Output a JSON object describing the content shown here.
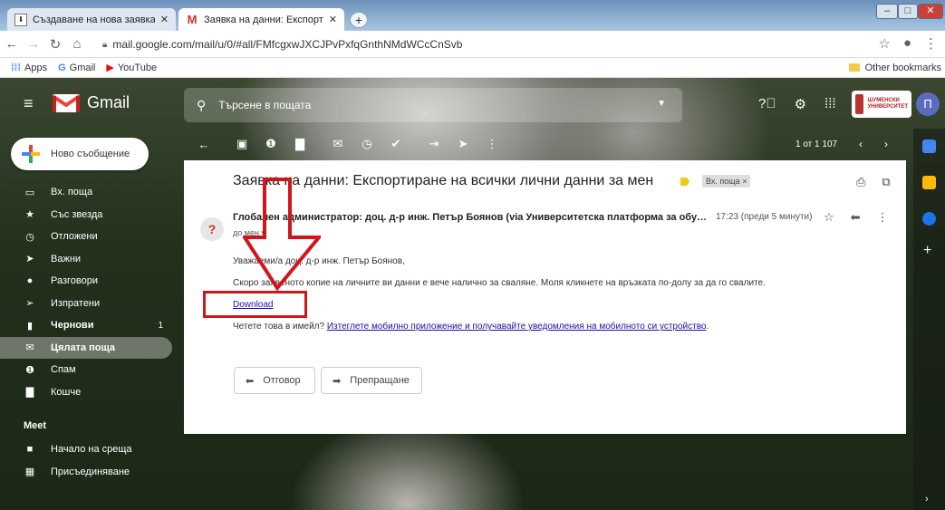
{
  "browser": {
    "tabs": [
      {
        "title": "Създаване на нова заявка за д",
        "close": "✕"
      },
      {
        "title": "Заявка на данни: Експортиране",
        "close": "✕"
      }
    ],
    "new_tab": "+",
    "url": "mail.google.com/mail/u/0/#all/FMfcgxwJXCJPvPxfqGnthNMdWCcCnSvb",
    "bookmarks": [
      {
        "label": "Apps",
        "icon": "apps-grid-icon"
      },
      {
        "label": "Gmail",
        "icon": "google-icon"
      },
      {
        "label": "YouTube",
        "icon": "youtube-icon"
      }
    ],
    "other_bookmarks": "Other bookmarks"
  },
  "gmail": {
    "app_name": "Gmail",
    "search_placeholder": "Търсене в пощата",
    "avatar_letter": "П",
    "university_label": "ШУМЕНСКИ УНИВЕРСИТЕТ",
    "compose": "Ново съобщение",
    "nav": [
      {
        "label": "Вх. поща",
        "icon": "inbox-icon"
      },
      {
        "label": "Със звезда",
        "icon": "star-icon"
      },
      {
        "label": "Отложени",
        "icon": "clock-icon"
      },
      {
        "label": "Важни",
        "icon": "important-icon"
      },
      {
        "label": "Разговори",
        "icon": "chat-icon"
      },
      {
        "label": "Изпратени",
        "icon": "send-icon"
      },
      {
        "label": "Чернови",
        "icon": "draft-icon",
        "count": "1"
      },
      {
        "label": "Цялата поща",
        "icon": "all-mail-icon"
      },
      {
        "label": "Спам",
        "icon": "spam-icon"
      },
      {
        "label": "Кошче",
        "icon": "trash-icon"
      }
    ],
    "meet_heading": "Meet",
    "meet": [
      {
        "label": "Начало на среща",
        "icon": "video-icon"
      },
      {
        "label": "Присъединяване",
        "icon": "keyboard-icon"
      }
    ],
    "pagination": "1 от 1 107",
    "message": {
      "subject": "Заявка на данни: Експортиране на всички лични данни за мен",
      "label": "Вх. поща ×",
      "sender": "Глобален администратор: доц. д-р инж. Петър Боянов (via Университетска платформа за обучени…",
      "time": "17:23 (преди 5 минути)",
      "to": "до мен ▾",
      "greeting": "Уважаеми/а доц. д-р инж. Петър Боянов,",
      "body1": "Скоро заявеното копие на личните ви данни е вече налично за сваляне. Моля кликнете на връзката по-долу за да го свалите.",
      "download": "Download",
      "body2_prefix": "Четете това в имейл?",
      "body2_link": "Изтеглете мобилно приложение и получавайте уведомления на мобилното си устройство",
      "body2_suffix": ".",
      "reply": "Отговор",
      "forward": "Препращане"
    }
  },
  "colors": {
    "highlight": "#d1151b",
    "gmail_red": "#ea4335",
    "link": "#1a0dab"
  }
}
